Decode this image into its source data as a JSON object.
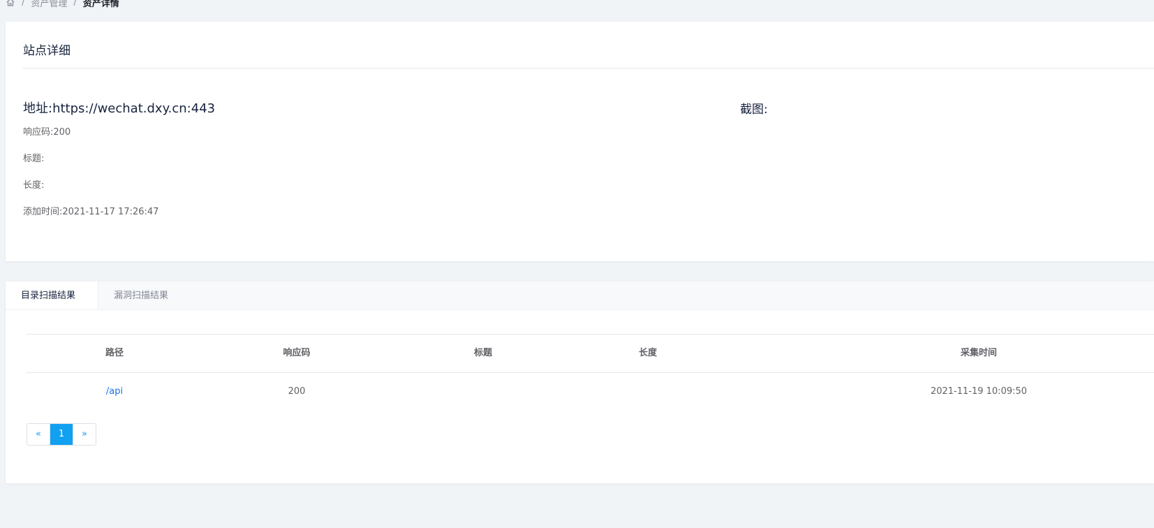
{
  "breadcrumb": {
    "home_icon": "home-icon",
    "items": [
      "资产管理",
      "资产详情"
    ]
  },
  "detail": {
    "title": "站点详细",
    "address": "地址:https://wechat.dxy.cn:443",
    "status": "响应码:200",
    "page_title": "标题:",
    "length": "长度:",
    "added_time": "添加时间:2021-11-17 17:26:47",
    "screenshot_label": "截图:"
  },
  "tabs": [
    {
      "label": "目录扫描结果",
      "active": true
    },
    {
      "label": "漏洞扫描结果",
      "active": false
    }
  ],
  "table": {
    "columns": [
      "路径",
      "响应码",
      "标题",
      "长度",
      "采集时间"
    ],
    "rows": [
      {
        "path": "/api",
        "code": "200",
        "title": "",
        "length": "",
        "time": "2021-11-19 10:09:50"
      }
    ]
  },
  "pagination": {
    "prev": "«",
    "pages": [
      "1"
    ],
    "next": "»",
    "current": "1"
  },
  "colors": {
    "accent": "#12a0f0",
    "link": "#1a73e8",
    "background": "#f1f4f7"
  }
}
